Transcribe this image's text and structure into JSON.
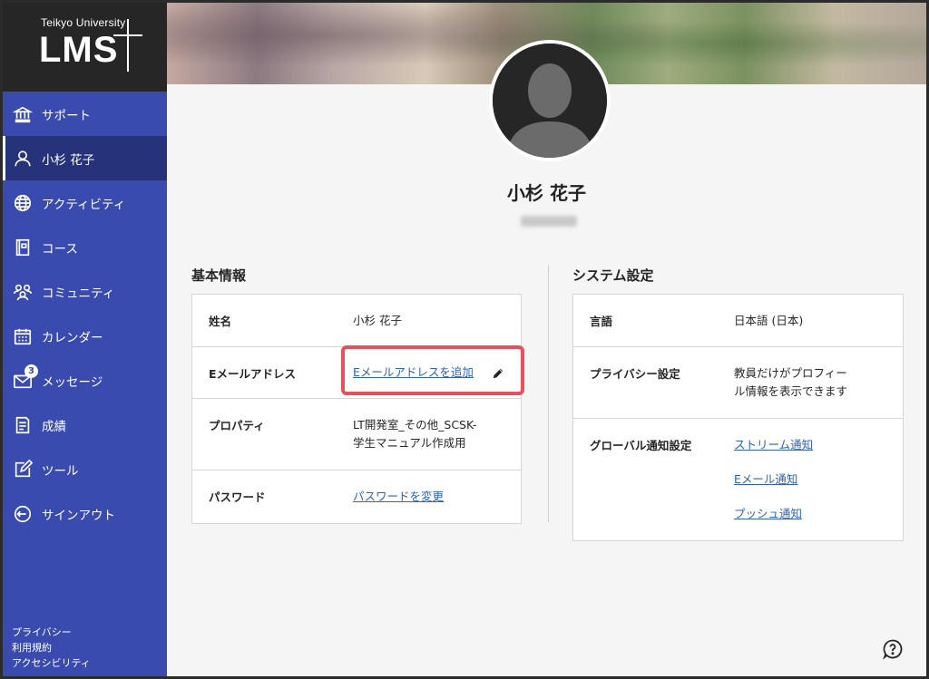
{
  "brand": {
    "university": "Teikyo University",
    "product": "LMS"
  },
  "sidebar": {
    "items": [
      {
        "label": "サポート",
        "icon": "bank-icon"
      },
      {
        "label": "小杉 花子",
        "icon": "user-icon",
        "active": true
      },
      {
        "label": "アクティビティ",
        "icon": "globe-icon"
      },
      {
        "label": "コース",
        "icon": "book-icon"
      },
      {
        "label": "コミュニティ",
        "icon": "community-icon"
      },
      {
        "label": "カレンダー",
        "icon": "calendar-icon"
      },
      {
        "label": "メッセージ",
        "icon": "mail-icon",
        "badge": "3"
      },
      {
        "label": "成績",
        "icon": "grades-icon"
      },
      {
        "label": "ツール",
        "icon": "tools-icon"
      },
      {
        "label": "サインアウト",
        "icon": "signout-icon"
      }
    ],
    "footer": {
      "privacy": "プライバシー",
      "terms": "利用規約",
      "accessibility": "アクセシビリティ"
    }
  },
  "profile": {
    "name": "小杉 花子"
  },
  "basic_info": {
    "title": "基本情報",
    "rows": {
      "name": {
        "label": "姓名",
        "value": "小杉 花子"
      },
      "email": {
        "label": "Eメールアドレス",
        "value": "Eメールアドレスを追加"
      },
      "property": {
        "label": "プロパティ",
        "value_line1": "LT開発室_その他_SCSK-",
        "value_line2": "学生マニュアル作成用"
      },
      "password": {
        "label": "パスワード",
        "value": "パスワードを変更"
      }
    }
  },
  "system_settings": {
    "title": "システム設定",
    "rows": {
      "language": {
        "label": "言語",
        "value": "日本語 (日本)"
      },
      "privacy": {
        "label": "プライバシー設定",
        "value_line1": "教員だけがプロフィー",
        "value_line2": "ル情報を表示できます"
      },
      "notifications": {
        "label": "グローバル通知設定",
        "stream": "ストリーム通知",
        "email": "Eメール通知",
        "push": "プッシュ通知"
      }
    }
  },
  "colors": {
    "sidebar": "#3a4bb0",
    "sidebar_active": "#26327a",
    "link": "#2f64b3",
    "highlight": "#e8505b"
  }
}
